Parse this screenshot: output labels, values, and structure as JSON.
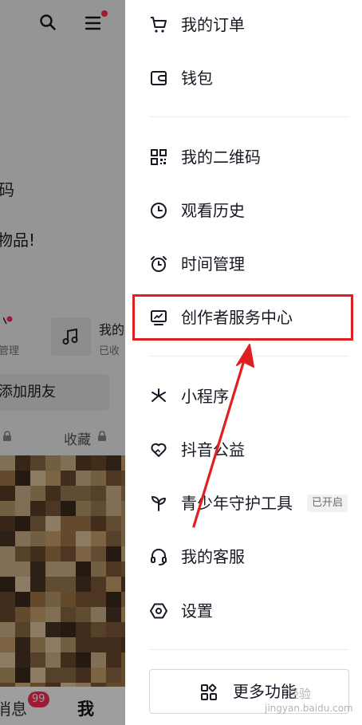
{
  "background_page": {
    "top_icons": [
      "search-icon",
      "menu-icon"
    ],
    "menu_notification_dot_color": "#fe2c55",
    "text_fragments": {
      "line1": "码",
      "line2": "物品!",
      "action_manage": "管理",
      "music_title": "我的",
      "music_sub": "已收",
      "add_friend": "添加朋友",
      "favorites": "收藏"
    },
    "bottom_nav": {
      "messages_label": "消息",
      "messages_badge": "99",
      "me_label": "我"
    }
  },
  "drawer": {
    "items": [
      {
        "id": "orders",
        "label": "我的订单",
        "icon": "cart-icon"
      },
      {
        "id": "wallet",
        "label": "钱包",
        "icon": "wallet-icon"
      },
      {
        "id": "qrcode",
        "label": "我的二维码",
        "icon": "qrcode-icon"
      },
      {
        "id": "history",
        "label": "观看历史",
        "icon": "clock-icon"
      },
      {
        "id": "time",
        "label": "时间管理",
        "icon": "alarm-clock-icon"
      },
      {
        "id": "creator",
        "label": "创作者服务中心",
        "icon": "creator-monitor-icon"
      },
      {
        "id": "miniapp",
        "label": "小程序",
        "icon": "asterisk-icon"
      },
      {
        "id": "charity",
        "label": "抖音公益",
        "icon": "heart-hands-icon"
      },
      {
        "id": "youth",
        "label": "青少年守护工具",
        "icon": "sprout-icon",
        "badge": "已开启"
      },
      {
        "id": "service",
        "label": "我的客服",
        "icon": "headset-icon"
      },
      {
        "id": "settings",
        "label": "设置",
        "icon": "settings-hexagon-icon"
      }
    ],
    "more_button": {
      "label": "更多功能",
      "icon": "grid-icon"
    }
  },
  "annotation": {
    "highlight_color": "#e02020",
    "highlighted_item": "创作者服务中心"
  },
  "watermark": {
    "line1": "经验",
    "line2": "jingyan.baidu.com"
  }
}
